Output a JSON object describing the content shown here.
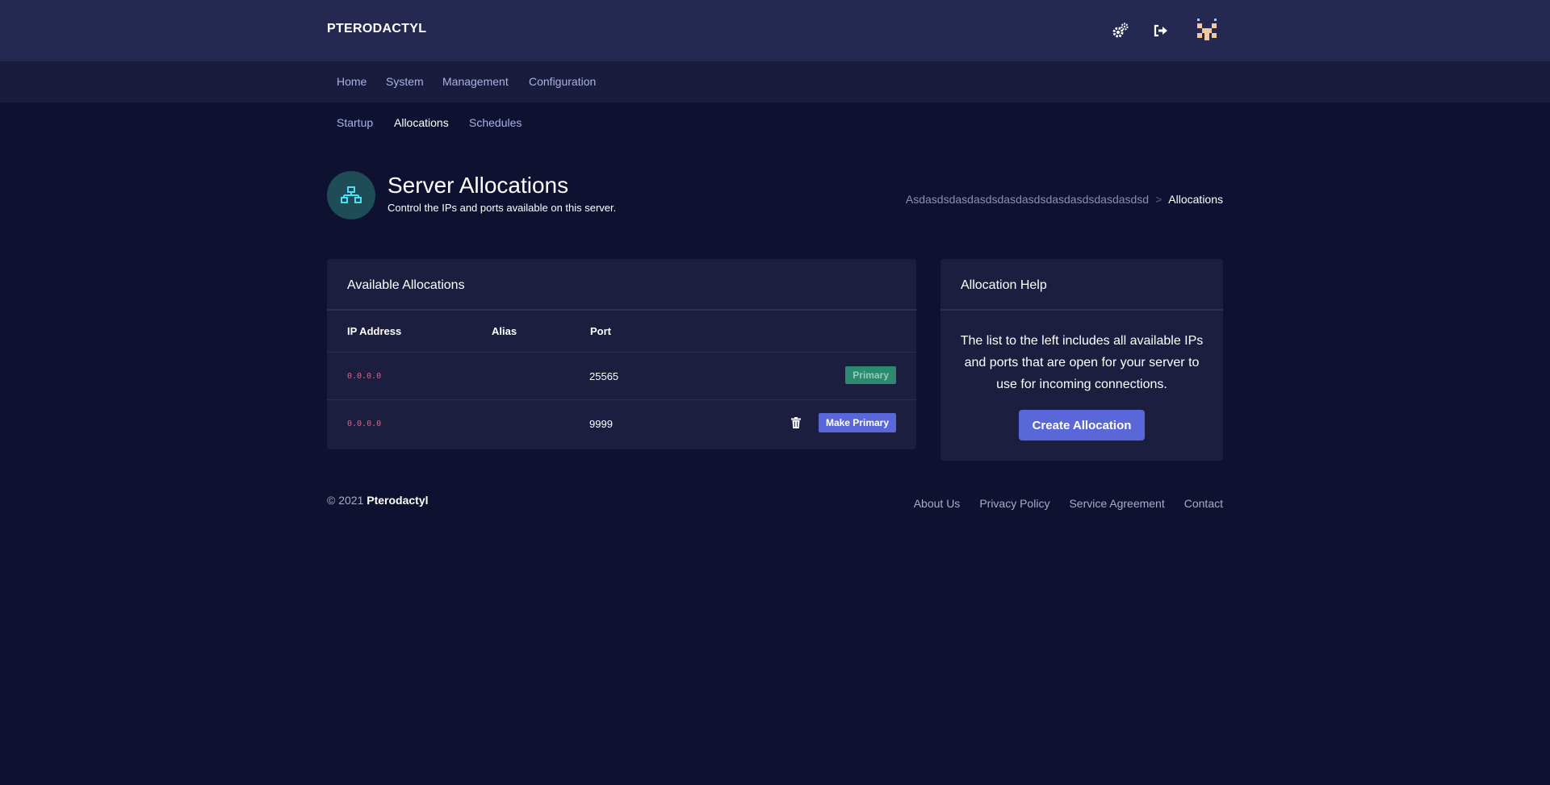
{
  "topbar": {
    "brand": "PTERODACTYL",
    "icons": [
      "settings-cogs-icon",
      "logout-icon",
      "user-avatar"
    ]
  },
  "main_nav": {
    "items": [
      {
        "label": "Home"
      },
      {
        "label": "System"
      },
      {
        "label": "Management"
      },
      {
        "label": "Configuration"
      }
    ]
  },
  "sub_nav": {
    "items": [
      {
        "label": "Startup",
        "active": false
      },
      {
        "label": "Allocations",
        "active": true
      },
      {
        "label": "Schedules",
        "active": false
      }
    ]
  },
  "header": {
    "icon": "network-icon",
    "title": "Server Allocations",
    "subtitle": "Control the IPs and ports available on this server.",
    "breadcrumb": {
      "server": "Asdasdsdasdasdsdasdasdsdasdasdsdasdasdsd",
      "separator": ">",
      "current": "Allocations"
    }
  },
  "allocations_card": {
    "title": "Available Allocations",
    "columns": [
      "IP Address",
      "Alias",
      "Port"
    ],
    "rows": [
      {
        "ip": "0.0.0.0",
        "alias": "",
        "port": "25565",
        "action": "Primary"
      },
      {
        "ip": "0.0.0.0",
        "alias": "",
        "port": "9999",
        "action": "Make Primary"
      }
    ]
  },
  "help_card": {
    "title": "Allocation Help",
    "text": "The list to the left includes all available IPs and ports that are open for your server to use for incoming connections.",
    "button": "Create Allocation"
  },
  "footer": {
    "copyright": "© 2021",
    "brand": "Pterodactyl",
    "links": [
      "About Us",
      "Privacy Policy",
      "Service Agreement",
      "Contact"
    ]
  },
  "colors": {
    "background": "#0f1131",
    "topbar": "#252850",
    "card": "#1c1e40",
    "accent": "#5a67d8",
    "primary_badge": "#2b8a6f",
    "ip_text": "#e0607e"
  }
}
